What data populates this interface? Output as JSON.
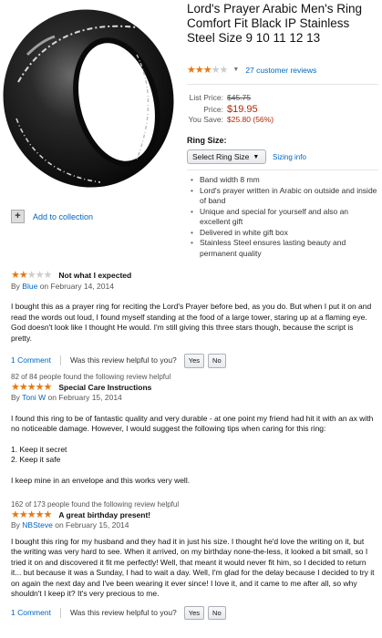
{
  "collection": {
    "label": "Add to collection"
  },
  "product": {
    "title": "Lord's Prayer Arabic Men's Ring Comfort Fit Black IP Stainless Steel Size 9 10 11 12 13",
    "rating_stars": 3,
    "review_count": "27 customer reviews",
    "list_price_label": "List Price:",
    "list_price": "$45.75",
    "price_label": "Price:",
    "price": "$19.95",
    "save_label": "You Save:",
    "save_value": "$25.80 (56%)",
    "ring_size_label": "Ring Size:",
    "size_select_value": "Select Ring Size",
    "sizing_info": "Sizing info",
    "features": [
      "Band width 8 mm",
      "Lord's prayer written in Arabic on outside and inside of band",
      "Unique and special for yourself and also an excellent gift",
      "Delivered in white gift box",
      "Stainless Steel ensures lasting beauty and permanent quality"
    ]
  },
  "reviews": [
    {
      "helpful_pre": "",
      "stars": 2,
      "title": "Not what I expected",
      "by": "By",
      "author": "Blue",
      "date": "on February 14, 2014",
      "paragraphs": [
        "I bought this as a prayer ring for reciting the Lord's Prayer before bed, as you do. But when I put it on and read the words out loud, I found myself standing at the food of a large tower, staring up at a flaming eye. God doesn't look like I thought He would. I'm still giving this three stars though, because the script is pretty."
      ],
      "comment": "1 Comment",
      "helpful_q": "Was this review helpful to you?",
      "yes": "Yes",
      "no": "No"
    },
    {
      "helpful_pre": "82 of 84 people found the following review helpful",
      "stars": 5,
      "title": "Special Care Instructions",
      "by": "By",
      "author": "Toni W",
      "date": "on February 15, 2014",
      "paragraphs": [
        "I found this ring to be of fantastic quality and very durable - at one point my friend had hit it with an ax with no noticeable damage. However, I would suggest the following tips when caring for this ring:",
        "1. Keep it secret",
        "2. Keep it safe",
        "I keep mine in an envelope and this works very well."
      ]
    },
    {
      "helpful_pre": "162 of 173 people found the following review helpful",
      "stars": 5,
      "title": "A great birthday present!",
      "by": "By",
      "author": "NBSteve",
      "date": "on February 15, 2014",
      "paragraphs": [
        "I bought this ring for my husband and they had it in just his size. I thought he'd love the writing on it, but the writing was very hard to see. When it arrived, on my birthday none-the-less, it looked a bit small, so I tried it on and discovered it fit me perfectly! Well, that meant it would never fit him, so I decided to return it... but because it was a Sunday, I had to wait a day. Well, I'm glad for the delay because I decided to try it on again the next day and I've been wearing it ever since! I love it, and it came to me after all, so why shouldn't I keep it? It's very precious to me."
      ],
      "comment": "1 Comment",
      "helpful_q": "Was this review helpful to you?",
      "yes": "Yes",
      "no": "No"
    }
  ],
  "colors": {
    "link": "#0066c0",
    "price": "#b12704",
    "star": "#e47911"
  },
  "icons": {
    "product_image": "black-ring-image",
    "plus": "plus-icon",
    "star": "star-icon",
    "chevron": "chevron-down-icon"
  }
}
